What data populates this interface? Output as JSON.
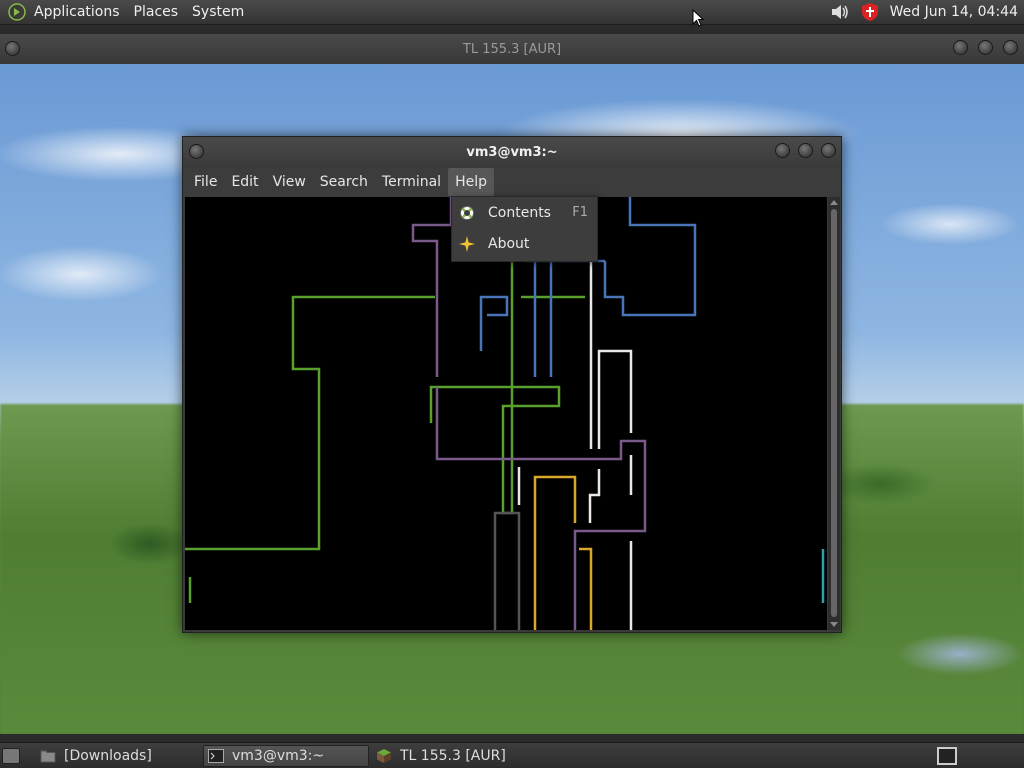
{
  "top_panel": {
    "menu": [
      "Applications",
      "Places",
      "System"
    ],
    "clock": "Wed Jun 14, 04:44"
  },
  "main_window": {
    "title": "TL 155.3 [AUR]"
  },
  "terminal": {
    "title": "vm3@vm3:~",
    "menu": [
      "File",
      "Edit",
      "View",
      "Search",
      "Terminal",
      "Help"
    ],
    "active_menu": "Help",
    "pipes_colors": {
      "green": "#5aa02c",
      "purple": "#7a5a8a",
      "blue": "#4a74b8",
      "white": "#e8e8e8",
      "yellow": "#d9a72b",
      "gray": "#555555",
      "cyan": "#2aa0a8"
    }
  },
  "help_menu": {
    "items": [
      {
        "label": "Contents",
        "accel": "F1",
        "icon": "lifebuoy-icon"
      },
      {
        "label": "About",
        "accel": "",
        "icon": "star-icon"
      }
    ]
  },
  "taskbar": {
    "items": [
      {
        "label": "[Downloads]",
        "icon": "folder-icon",
        "active": false
      },
      {
        "label": "vm3@vm3:~",
        "icon": "terminal-icon",
        "active": true
      },
      {
        "label": "TL 155.3 [AUR]",
        "icon": "minecraft-block-icon",
        "active": false
      }
    ]
  }
}
